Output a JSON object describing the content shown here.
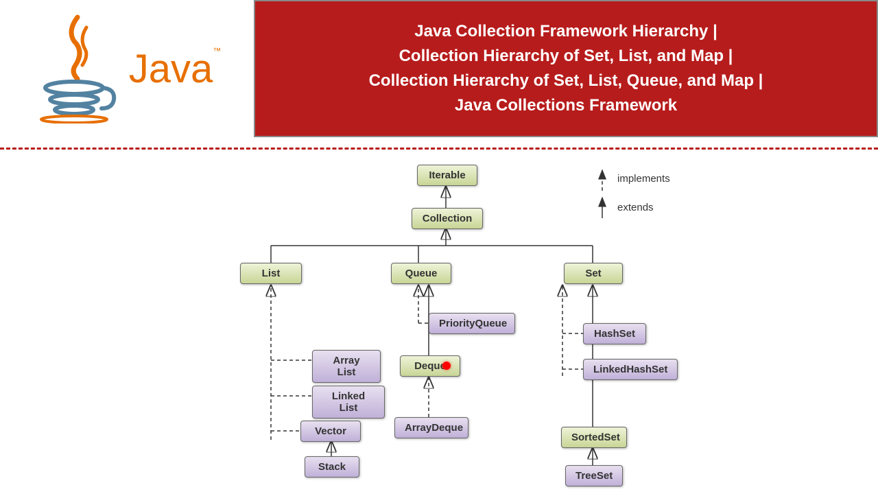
{
  "header": {
    "logo_text": "Java",
    "tm": "™",
    "title_lines": [
      "Java Collection Framework Hierarchy |",
      "Collection Hierarchy of Set, List, and Map |",
      "Collection Hierarchy of Set, List, Queue, and Map |",
      "Java Collections Framework"
    ]
  },
  "legend": {
    "implements": "implements",
    "extends": "extends"
  },
  "nodes": {
    "iterable": "Iterable",
    "collection": "Collection",
    "list": "List",
    "queue": "Queue",
    "set": "Set",
    "arraylist": "Array List",
    "linkedlist": "Linked List",
    "vector": "Vector",
    "stack": "Stack",
    "priorityqueue": "PriorityQueue",
    "deque": "Deque",
    "arraydeque": "ArrayDeque",
    "hashset": "HashSet",
    "linkedhashset": "LinkedHashSet",
    "sortedset": "SortedSet",
    "treeset": "TreeSet"
  },
  "chart_data": {
    "type": "hierarchy-diagram",
    "title": "Java Collection Framework Hierarchy",
    "relationships": {
      "extends": [
        [
          "Collection",
          "Iterable"
        ],
        [
          "List",
          "Collection"
        ],
        [
          "Queue",
          "Collection"
        ],
        [
          "Set",
          "Collection"
        ],
        [
          "Deque",
          "Queue"
        ],
        [
          "SortedSet",
          "Set"
        ],
        [
          "Stack",
          "Vector"
        ]
      ],
      "implements": [
        [
          "Array List",
          "List"
        ],
        [
          "Linked List",
          "List"
        ],
        [
          "Vector",
          "List"
        ],
        [
          "PriorityQueue",
          "Queue"
        ],
        [
          "ArrayDeque",
          "Deque"
        ],
        [
          "HashSet",
          "Set"
        ],
        [
          "LinkedHashSet",
          "Set"
        ],
        [
          "LinkedHashSet",
          "HashSet"
        ],
        [
          "TreeSet",
          "SortedSet"
        ]
      ]
    },
    "interfaces": [
      "Iterable",
      "Collection",
      "List",
      "Queue",
      "Set",
      "Deque",
      "SortedSet"
    ],
    "classes": [
      "Array List",
      "Linked List",
      "Vector",
      "Stack",
      "PriorityQueue",
      "ArrayDeque",
      "HashSet",
      "LinkedHashSet",
      "TreeSet"
    ]
  }
}
